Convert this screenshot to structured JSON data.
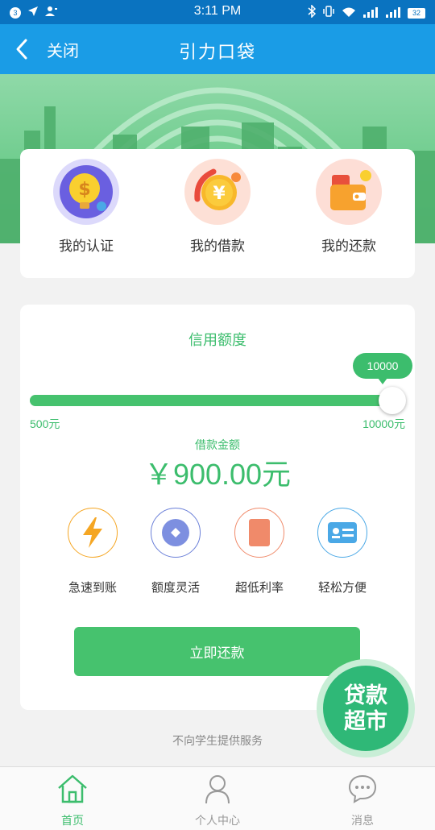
{
  "status_bar": {
    "time": "3:11 PM",
    "notification_count": "3",
    "battery": "32"
  },
  "header": {
    "back_label": "关闭",
    "title": "引力口袋"
  },
  "shortcuts": [
    {
      "label": "我的认证",
      "icon": "dollar-bulb-icon"
    },
    {
      "label": "我的借款",
      "icon": "yuan-coin-icon"
    },
    {
      "label": "我的还款",
      "icon": "wallet-icon"
    }
  ],
  "credit": {
    "title": "信用额度",
    "slider_value": "10000",
    "slider_fraction": 1.0,
    "min_label": "500元",
    "max_label": "10000元",
    "loan_label": "借款金额",
    "loan_amount": "￥900.00元"
  },
  "features": [
    {
      "label": "急速到账",
      "icon": "lightning-icon",
      "color": "#f5a623"
    },
    {
      "label": "额度灵活",
      "icon": "diamond-icon",
      "color": "#6a7fd8"
    },
    {
      "label": "超低利率",
      "icon": "rate-card-icon",
      "color": "#f08a6a"
    },
    {
      "label": "轻松方便",
      "icon": "id-card-icon",
      "color": "#4aa8e6"
    }
  ],
  "repay_button": "立即还款",
  "notice": "不向学生提供服务",
  "float_button": {
    "line1": "贷款",
    "line2": "超市"
  },
  "bottom_nav": [
    {
      "label": "首页",
      "active": true
    },
    {
      "label": "个人中心",
      "active": false
    },
    {
      "label": "消息",
      "active": false
    }
  ],
  "colors": {
    "accent": "#3cbd6d",
    "header": "#1a9ce6",
    "statusbar": "#0a73c0",
    "inactive": "#999999"
  }
}
